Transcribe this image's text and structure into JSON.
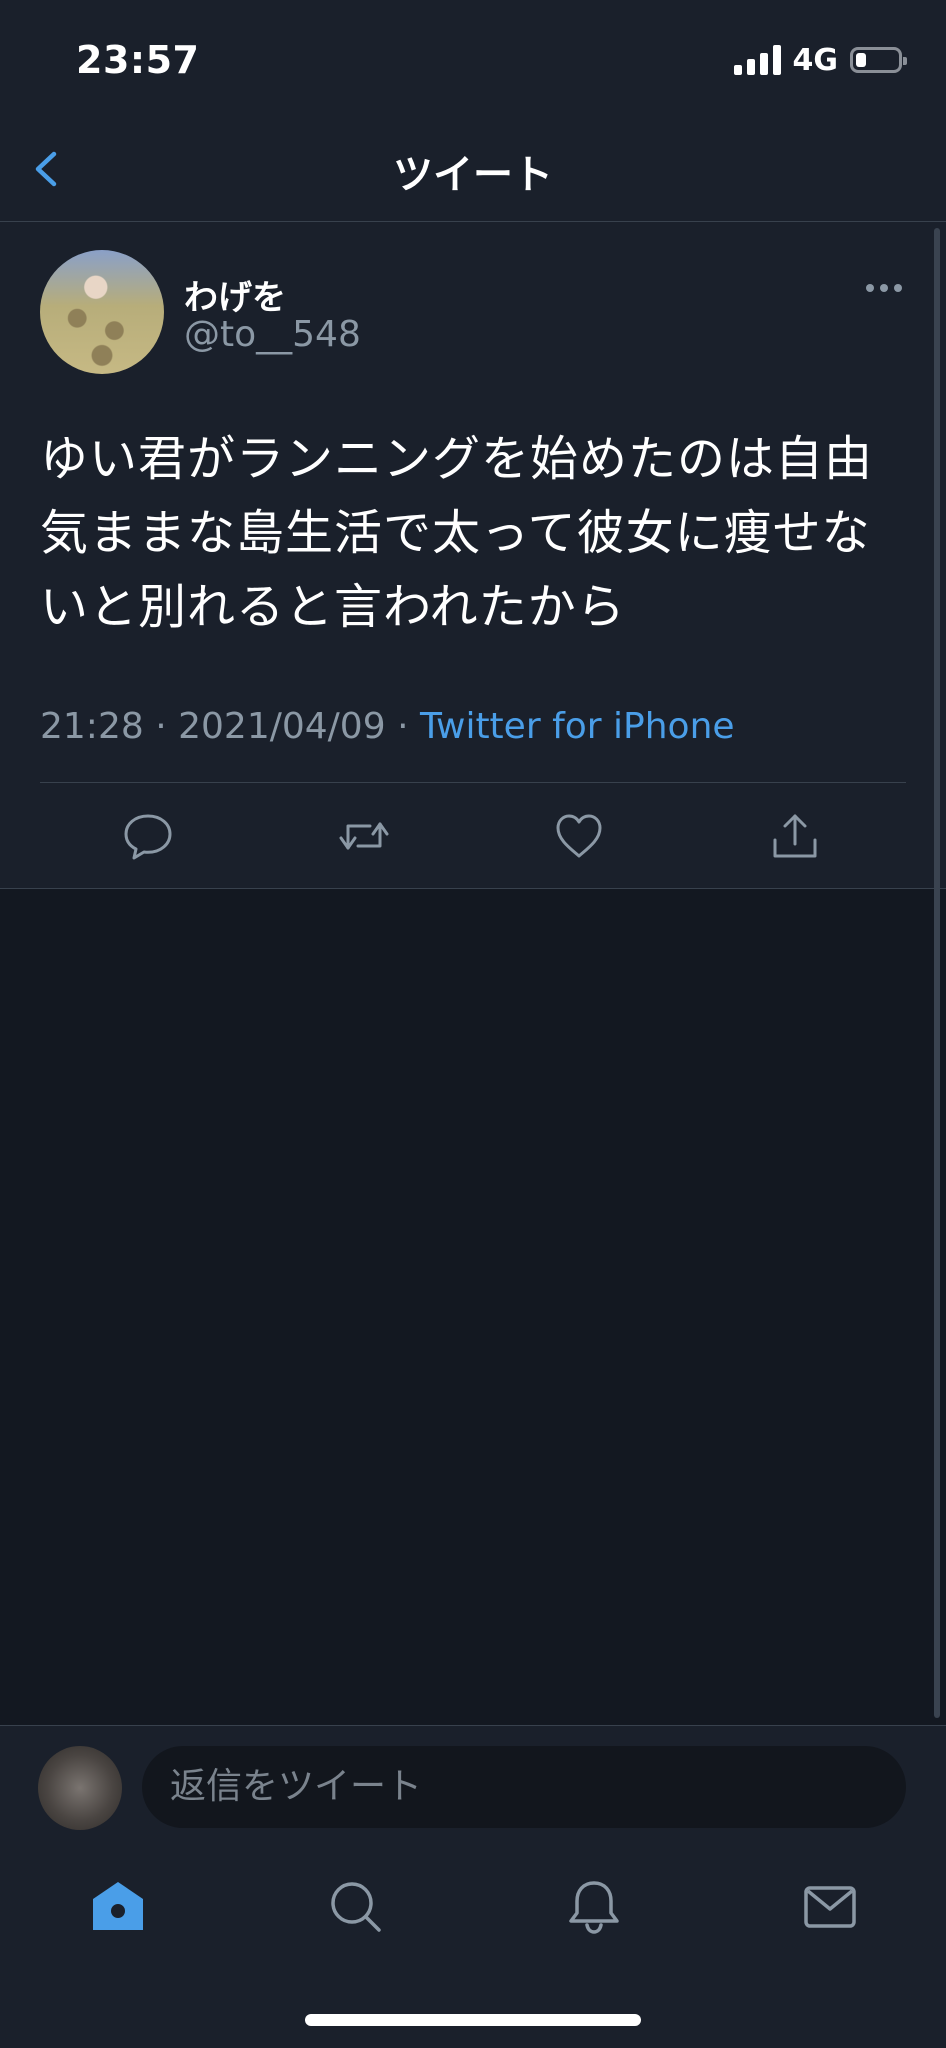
{
  "status_bar": {
    "time": "23:57",
    "network": "4G",
    "battery_level": 0.25
  },
  "nav": {
    "title": "ツイート",
    "back_icon": "chevron-left-icon"
  },
  "tweet": {
    "author_name": "わげを",
    "author_handle": "@to__548",
    "text": "ゆい君がランニングを始めたのは自由気ままな島生活で太って彼女に痩せないと別れると言われたから",
    "time": "21:28",
    "date": "2021/04/09",
    "separator": "·",
    "source": "Twitter for iPhone",
    "actions": [
      "reply-icon",
      "retweet-icon",
      "like-icon",
      "share-icon"
    ]
  },
  "reply": {
    "placeholder": "返信をツイート"
  },
  "tabs": [
    "home-icon",
    "search-icon",
    "notifications-icon",
    "messages-icon"
  ],
  "colors": {
    "background": "#131821",
    "surface": "#1a202b",
    "accent": "#4a9ee8",
    "muted": "#8b98a5"
  }
}
